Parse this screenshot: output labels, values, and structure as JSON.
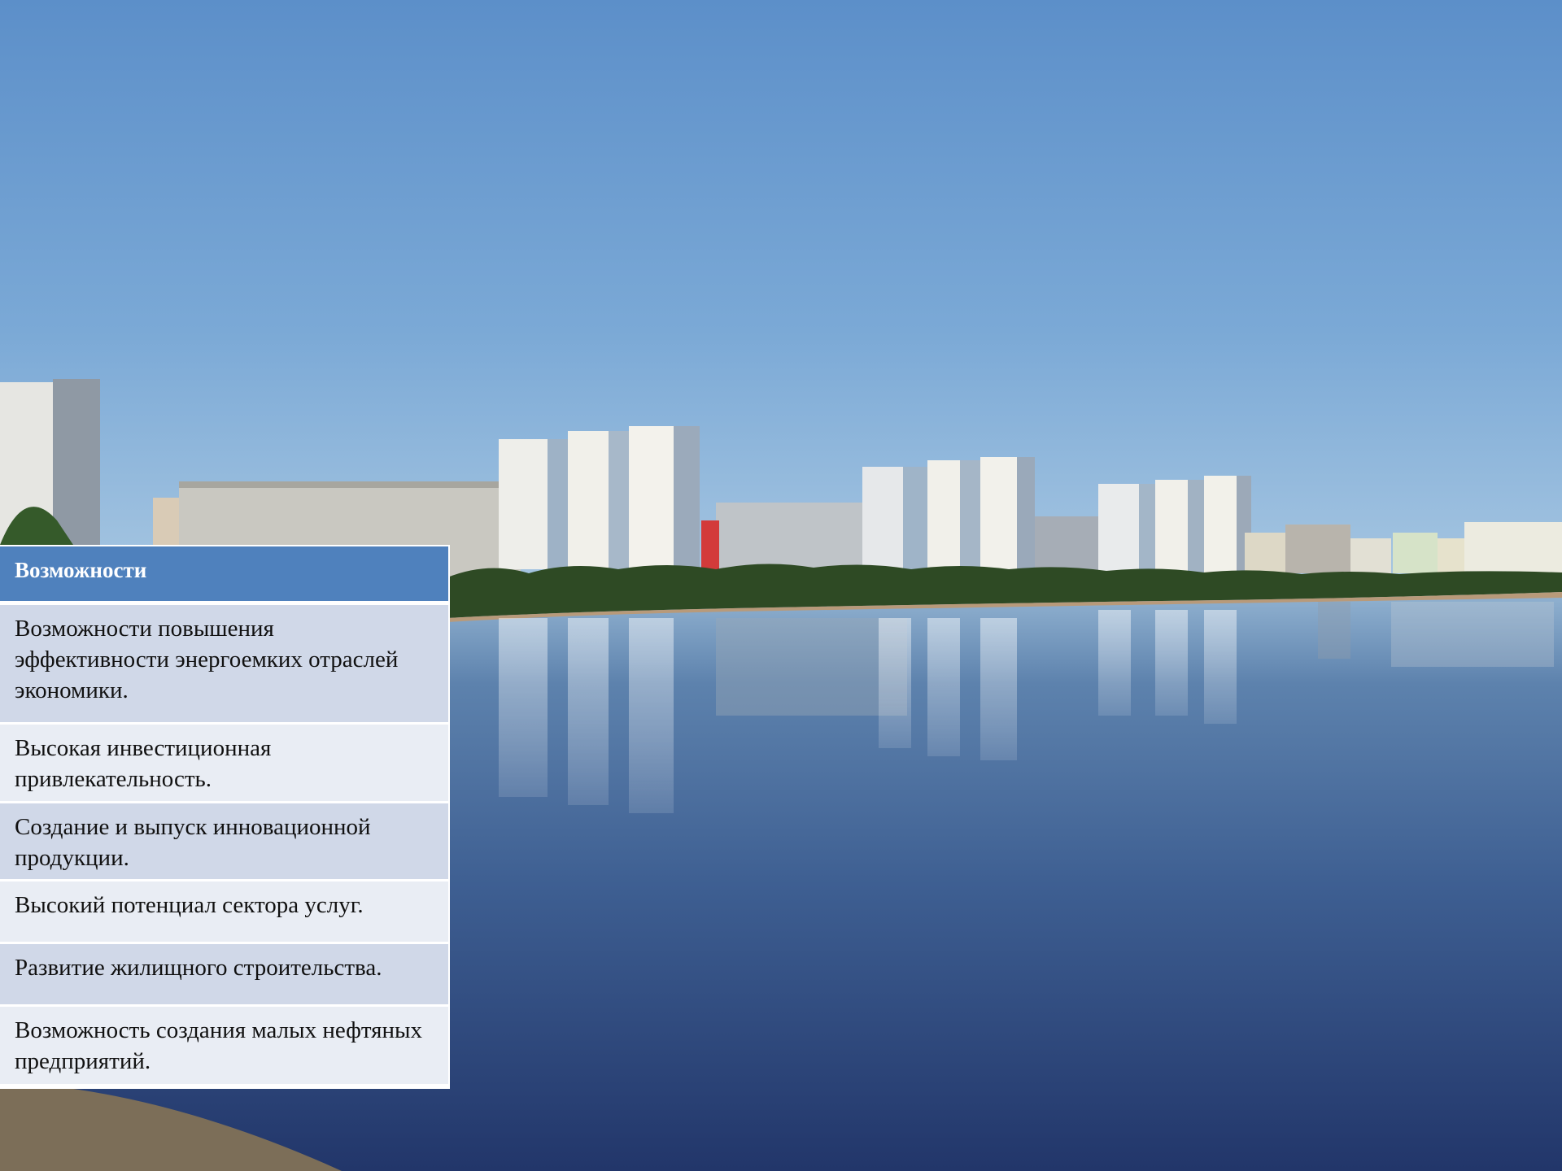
{
  "table": {
    "header": "Возможности",
    "rows": [
      "Возможности повышения эффективности энергоемких отраслей экономики.",
      "Высокая инвестиционная привлекательность.",
      "Создание и выпуск инновационной продукции.",
      "Высокий потенциал сектора услуг.",
      "Развитие жилищного строительства.",
      "Возможность создания малых нефтяных предприятий."
    ]
  },
  "colors": {
    "header_bg": "#4f81bd",
    "row_dark_bg": "#d0d8e8",
    "row_light_bg": "#e9edf4",
    "sky_top": "#5c8fc9",
    "water_bottom": "#24386b"
  }
}
